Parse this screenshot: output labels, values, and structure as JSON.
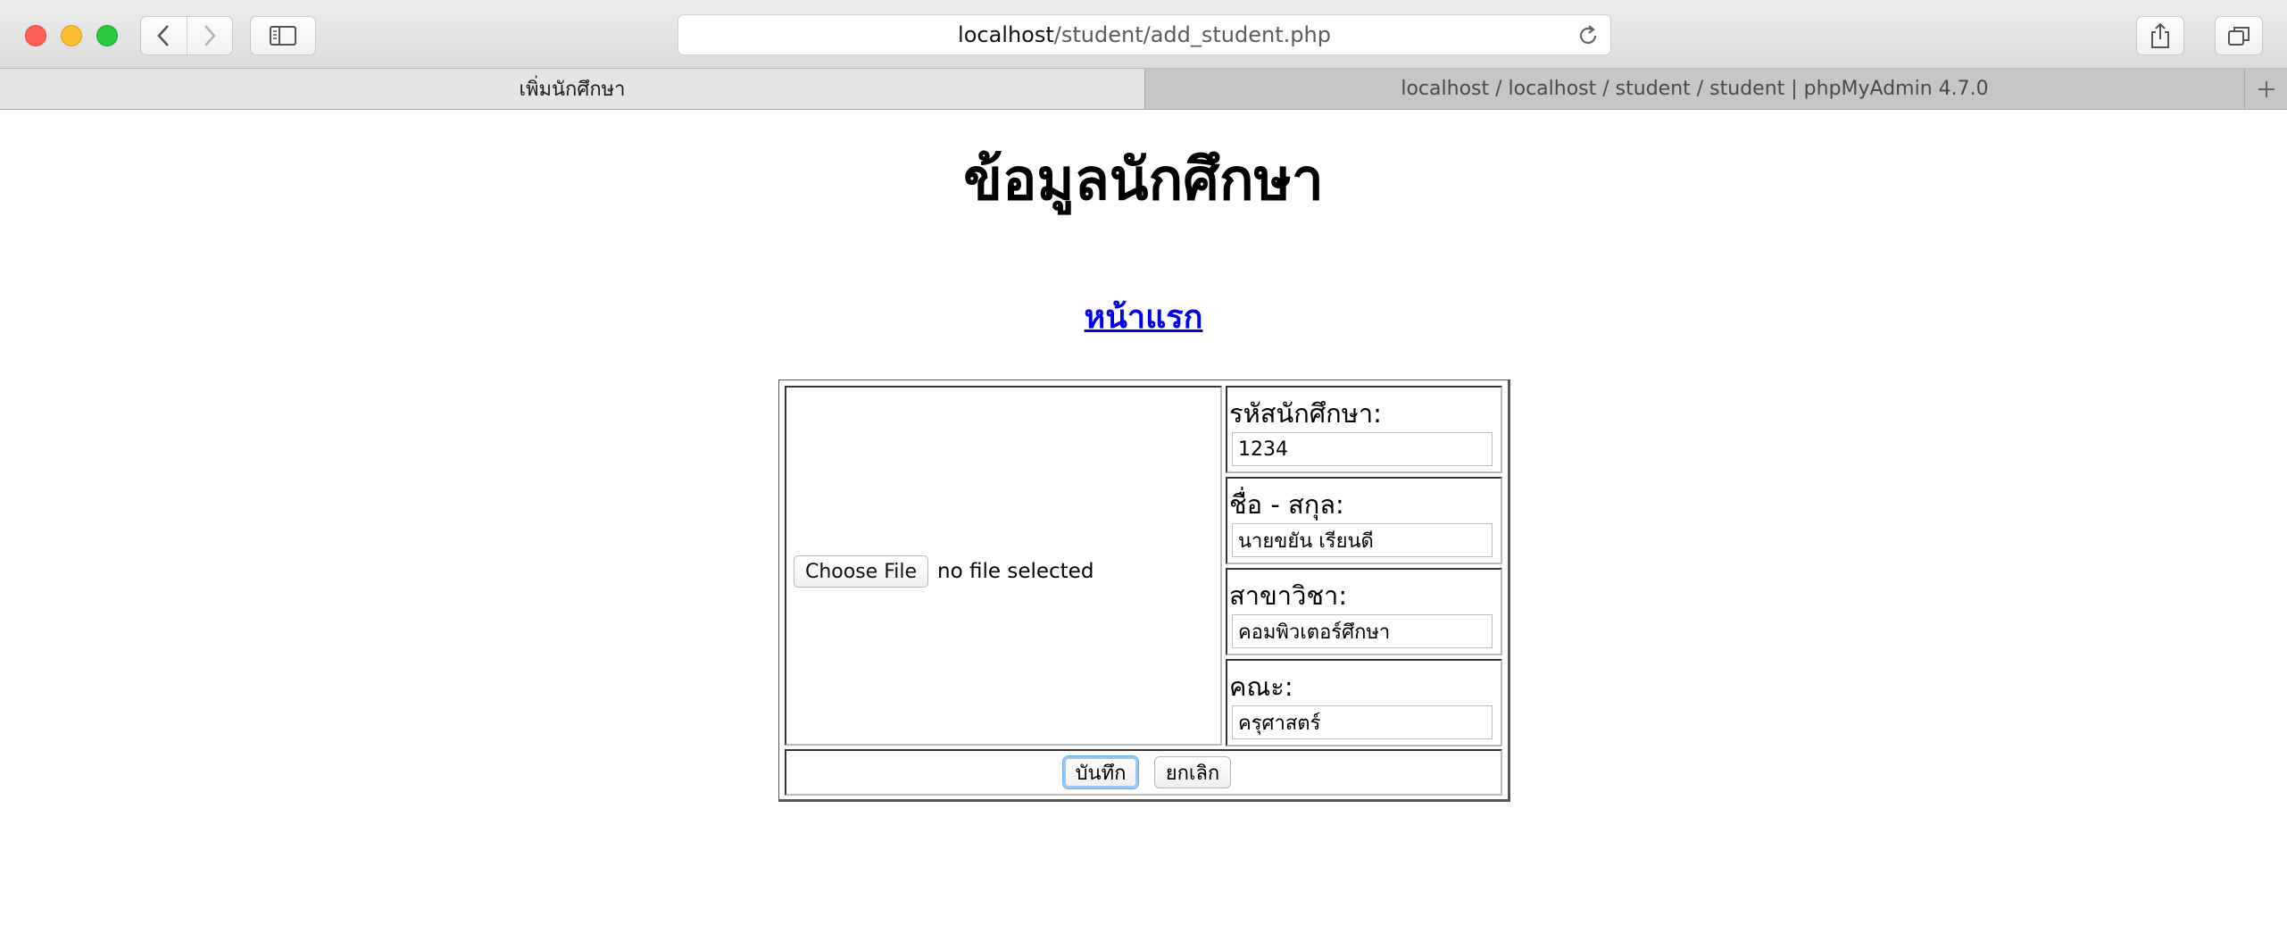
{
  "browser": {
    "url_host": "localhost",
    "url_path": "/student/add_student.php",
    "tabs": [
      {
        "label": "เพิ่มนักศึกษา",
        "active": true
      },
      {
        "label": "localhost / localhost / student / student | phpMyAdmin 4.7.0",
        "active": false
      }
    ],
    "icons": {
      "back": "back-chevron-icon",
      "forward": "forward-chevron-icon",
      "sidebar": "sidebar-icon",
      "reload": "reload-icon",
      "share": "share-icon",
      "tabs": "tabs-overview-icon",
      "new_tab": "plus-icon"
    }
  },
  "page": {
    "title": "ข้อมูลนักศึกษา",
    "home_link": "หน้าแรก",
    "file": {
      "button_label": "Choose File",
      "status": "no file selected"
    },
    "fields": [
      {
        "label": "รหัสนักศึกษา:",
        "value": "1234"
      },
      {
        "label": "ชื่อ - สกุล:",
        "value": "นายขยัน เรียนดี"
      },
      {
        "label": "สาขาวิชา:",
        "value": "คอมพิวเตอร์ศึกษา"
      },
      {
        "label": "คณะ:",
        "value": "ครุศาสตร์"
      }
    ],
    "buttons": {
      "save": "บันทึก",
      "cancel": "ยกเลิก"
    }
  },
  "colors": {
    "link": "#0000ee",
    "focus_ring": "#9ac6f6"
  }
}
